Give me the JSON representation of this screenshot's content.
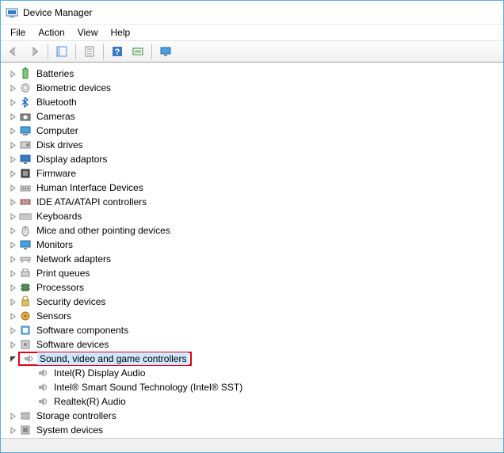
{
  "window": {
    "title": "Device Manager"
  },
  "menu": {
    "file": "File",
    "action": "Action",
    "view": "View",
    "help": "Help"
  },
  "tree": {
    "items": [
      {
        "label": "Batteries",
        "icon": "battery"
      },
      {
        "label": "Biometric devices",
        "icon": "biometric"
      },
      {
        "label": "Bluetooth",
        "icon": "bluetooth"
      },
      {
        "label": "Cameras",
        "icon": "camera"
      },
      {
        "label": "Computer",
        "icon": "computer"
      },
      {
        "label": "Disk drives",
        "icon": "disk"
      },
      {
        "label": "Display adaptors",
        "icon": "display"
      },
      {
        "label": "Firmware",
        "icon": "firmware"
      },
      {
        "label": "Human Interface Devices",
        "icon": "hid"
      },
      {
        "label": "IDE ATA/ATAPI controllers",
        "icon": "ide"
      },
      {
        "label": "Keyboards",
        "icon": "keyboard"
      },
      {
        "label": "Mice and other pointing devices",
        "icon": "mouse"
      },
      {
        "label": "Monitors",
        "icon": "monitor"
      },
      {
        "label": "Network adapters",
        "icon": "network"
      },
      {
        "label": "Print queues",
        "icon": "print"
      },
      {
        "label": "Processors",
        "icon": "cpu"
      },
      {
        "label": "Security devices",
        "icon": "security"
      },
      {
        "label": "Sensors",
        "icon": "sensor"
      },
      {
        "label": "Software components",
        "icon": "swcomp"
      },
      {
        "label": "Software devices",
        "icon": "swdev"
      }
    ],
    "sound": {
      "label": "Sound, video and game controllers",
      "children": [
        {
          "label": "Intel(R) Display Audio"
        },
        {
          "label": "Intel® Smart Sound Technology (Intel® SST)"
        },
        {
          "label": "Realtek(R) Audio"
        }
      ]
    },
    "tail": [
      {
        "label": "Storage controllers",
        "icon": "storage"
      },
      {
        "label": "System devices",
        "icon": "system"
      }
    ]
  }
}
